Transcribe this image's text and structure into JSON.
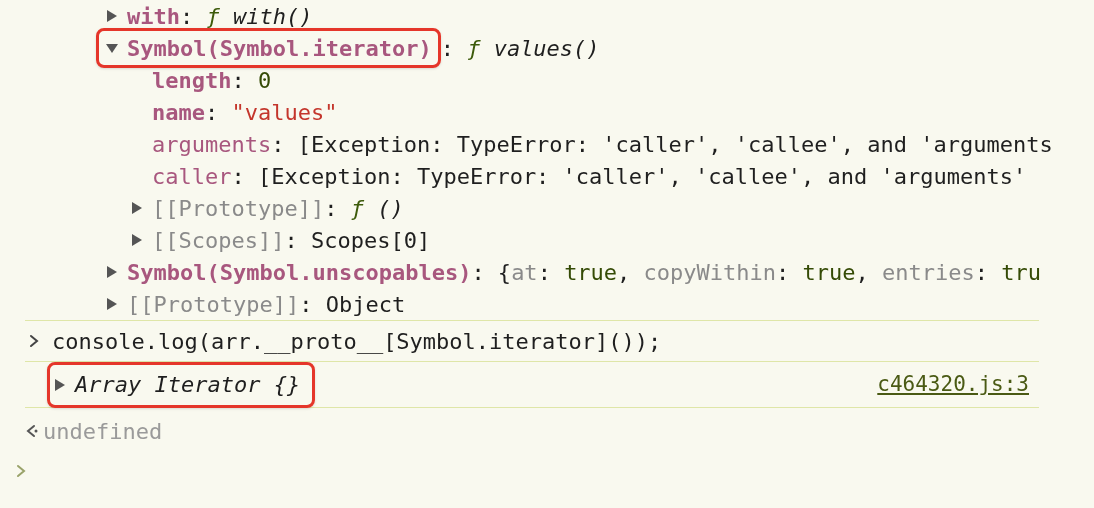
{
  "properties": [
    {
      "kind": "own",
      "expanded": false,
      "highlighted": false,
      "key": "with",
      "value": [
        {
          "kind": "punct",
          "text": ": "
        },
        {
          "kind": "func",
          "text": "ƒ"
        },
        {
          "kind": "italic",
          "text": " with()"
        }
      ]
    },
    {
      "kind": "own",
      "expanded": true,
      "highlighted": true,
      "key": "Symbol(Symbol.iterator)",
      "value": [
        {
          "kind": "punct",
          "text": ": "
        },
        {
          "kind": "func",
          "text": "ƒ"
        },
        {
          "kind": "italic",
          "text": " values()"
        }
      ],
      "children": [
        {
          "kind": "own",
          "highlighted": false,
          "key": "length",
          "value": [
            {
              "kind": "punct",
              "text": ": "
            },
            {
              "kind": "number",
              "text": "0"
            }
          ]
        },
        {
          "kind": "own",
          "highlighted": false,
          "key": "name",
          "value": [
            {
              "kind": "punct",
              "text": ": "
            },
            {
              "kind": "string",
              "text": "\"values\""
            }
          ]
        },
        {
          "kind": "accessor",
          "highlighted": false,
          "key": "arguments",
          "value": [
            {
              "kind": "punct",
              "text": ": [Exception: TypeError: 'caller', 'callee', and 'arguments"
            }
          ]
        },
        {
          "kind": "accessor",
          "highlighted": false,
          "key": "caller",
          "value": [
            {
              "kind": "punct",
              "text": ": [Exception: TypeError: 'caller', 'callee', and 'arguments'"
            }
          ]
        },
        {
          "kind": "internal",
          "expanded": false,
          "highlighted": false,
          "key": "[[Prototype]]",
          "value": [
            {
              "kind": "punct",
              "text": ": "
            },
            {
              "kind": "func",
              "text": "ƒ"
            },
            {
              "kind": "italic",
              "text": " ()"
            }
          ]
        },
        {
          "kind": "internal",
          "expanded": false,
          "highlighted": false,
          "key": "[[Scopes]]",
          "value": [
            {
              "kind": "punct",
              "text": ": Scopes[0]"
            }
          ]
        }
      ]
    },
    {
      "kind": "own",
      "expanded": false,
      "highlighted": false,
      "key": "Symbol(Symbol.unscopables)",
      "value": [
        {
          "kind": "punct",
          "text": ": {"
        },
        {
          "kind": "dimkey",
          "text": "at"
        },
        {
          "kind": "punct",
          "text": ": "
        },
        {
          "kind": "number",
          "text": "true"
        },
        {
          "kind": "punct",
          "text": ", "
        },
        {
          "kind": "dimkey",
          "text": "copyWithin"
        },
        {
          "kind": "punct",
          "text": ": "
        },
        {
          "kind": "number",
          "text": "true"
        },
        {
          "kind": "punct",
          "text": ", "
        },
        {
          "kind": "dimkey",
          "text": "entries"
        },
        {
          "kind": "punct",
          "text": ": "
        },
        {
          "kind": "number",
          "text": "tru"
        }
      ]
    },
    {
      "kind": "internal",
      "expanded": false,
      "highlighted": false,
      "key": "[[Prototype]]",
      "value": [
        {
          "kind": "punct",
          "text": ": Object"
        }
      ]
    }
  ],
  "console": [
    {
      "kind": "input",
      "text": "console.log(arr.__proto__[Symbol.iterator]());"
    },
    {
      "kind": "log",
      "expanded": false,
      "highlighted": true,
      "text": "Array Iterator {}",
      "source": "c464320.js:3"
    },
    {
      "kind": "result",
      "text": "undefined"
    },
    {
      "kind": "prompt"
    }
  ]
}
